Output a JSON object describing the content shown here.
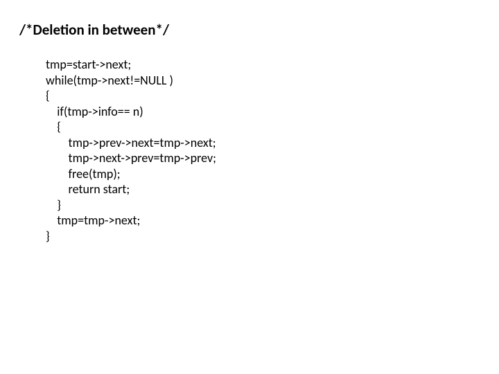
{
  "title": "/*Deletion in between*/",
  "code": "tmp=start->next;\nwhile(tmp->next!=NULL )\n{\n    if(tmp->info== n)\n    {\n        tmp->prev->next=tmp->next;\n        tmp->next->prev=tmp->prev;\n        free(tmp);\n        return start;\n    }\n    tmp=tmp->next;\n}"
}
